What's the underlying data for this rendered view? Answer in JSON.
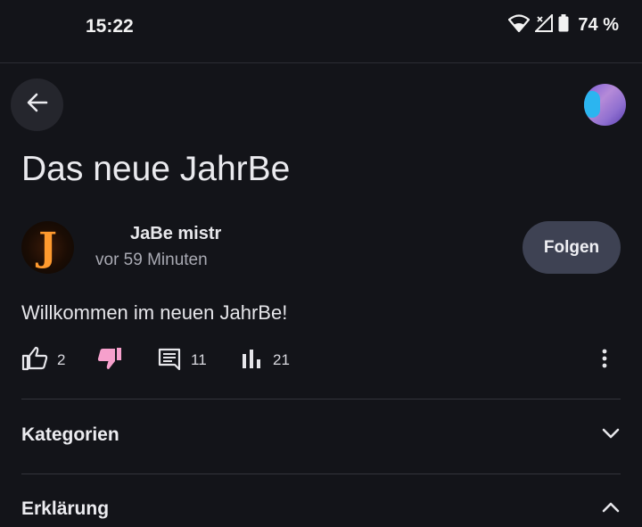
{
  "status": {
    "time": "15:22",
    "battery": "74 %"
  },
  "post": {
    "title": "Das neue JahrBe",
    "author": "JaBe mistr",
    "timestamp": "vor 59 Minuten",
    "avatar_letter": "J",
    "follow_label": "Folgen",
    "body": "Willkommen im neuen JahrBe!"
  },
  "actions": {
    "likes": "2",
    "comments": "11",
    "views": "21"
  },
  "sections": {
    "categories": "Kategorien",
    "explanation": "Erklärung"
  },
  "colors": {
    "background": "#131419",
    "dislike_active": "#f6a0cc",
    "follow_bg": "#3e4253"
  }
}
